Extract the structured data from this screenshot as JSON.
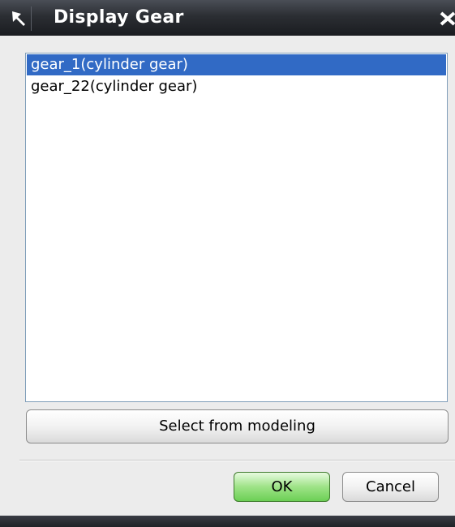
{
  "window": {
    "title": "Display Gear",
    "title_icon": "pin-arrow-icon",
    "close_icon": "close-icon"
  },
  "list": {
    "items": [
      {
        "label": "gear_1(cylinder gear)",
        "selected": true
      },
      {
        "label": "gear_22(cylinder gear)",
        "selected": false
      }
    ]
  },
  "buttons": {
    "select_from_modeling": "Select from modeling",
    "ok": "OK",
    "cancel": "Cancel"
  },
  "colors": {
    "titlebar": "#2b2e33",
    "selection": "#316ac5",
    "ok_button": "#9ee387"
  }
}
